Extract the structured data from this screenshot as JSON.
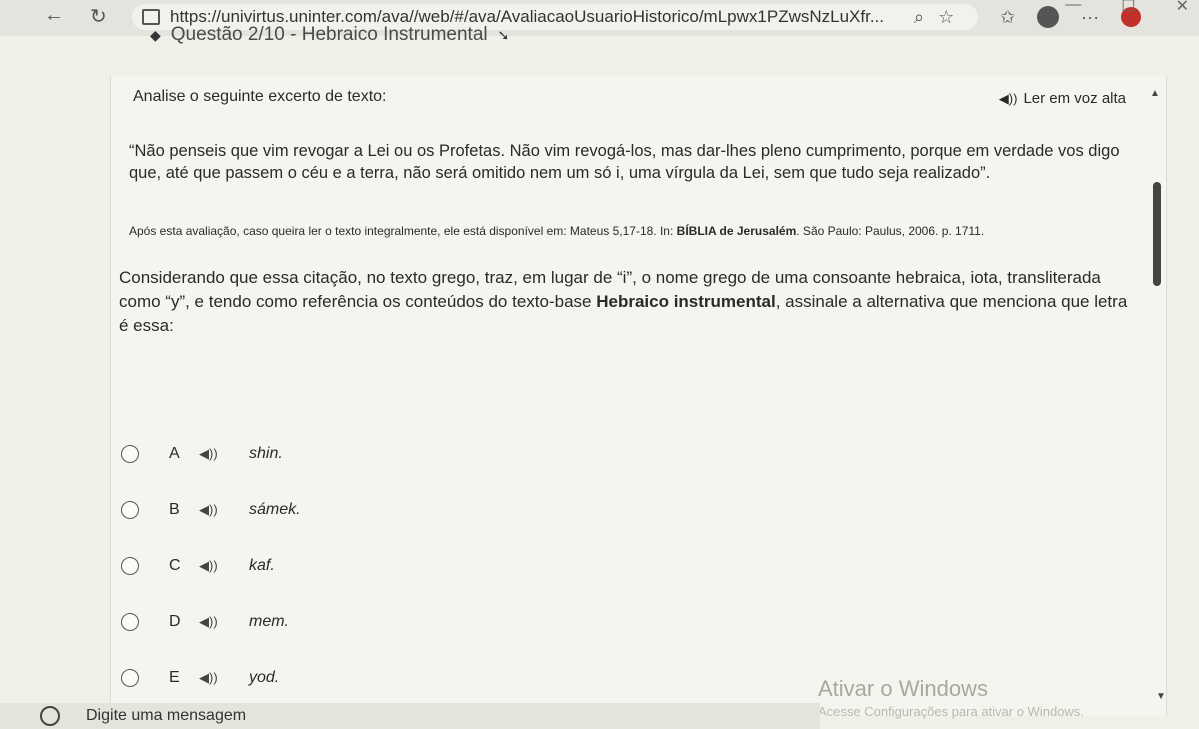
{
  "browser": {
    "url": "https://univirtus.uninter.com/ava//web/#/ava/AvaliacaoUsuarioHistorico/mLpwx1PZwsNzLuXfr...",
    "back_icon": "←",
    "refresh_icon": "↻",
    "search_icon": "⌕",
    "favorite_icon": "☆",
    "collections_icon": "✩",
    "more_icon": "···",
    "minimize_icon": "—",
    "maximize_icon": "☐",
    "close_icon": "✕"
  },
  "header": {
    "title": "Questão 2/10 - Hebraico Instrumental"
  },
  "question": {
    "prompt_label": "Analise o seguinte excerto de texto:",
    "read_aloud_label": "Ler em voz alta",
    "quote_text": "“Não penseis que vim revogar a Lei ou os Profetas. Não vim revogá-los, mas dar-lhes pleno cumprimento, porque em verdade vos digo que, até que passem o céu e a terra, não será omitido nem um só i, uma vírgula da Lei, sem que tudo seja realizado”.",
    "reference_prefix": "Após esta avaliação, caso queira ler o texto integralmente, ele está disponível em: Mateus 5,17-18. In: ",
    "reference_bold": "BÍBLIA de Jerusalém",
    "reference_suffix": ". São Paulo: Paulus, 2006. p. 1711.",
    "body_prefix": "Considerando que essa citação, no texto grego, traz, em lugar de “i”, o nome grego de uma consoante hebraica, iota, transliterada como “y”, e tendo como referência os conteúdos do texto-base ",
    "body_bold": "Hebraico instrumental",
    "body_suffix": ", assinale a alternativa que menciona que letra é essa:"
  },
  "options": [
    {
      "letter": "A",
      "text": "shin."
    },
    {
      "letter": "B",
      "text": "sámek."
    },
    {
      "letter": "C",
      "text": "kaf."
    },
    {
      "letter": "D",
      "text": "mem."
    },
    {
      "letter": "E",
      "text": "yod."
    }
  ],
  "watermark": {
    "title": "Ativar o Windows",
    "subtitle": "Acesse Configurações para ativar o Windows."
  },
  "chat": {
    "placeholder": "Digite uma mensagem"
  }
}
